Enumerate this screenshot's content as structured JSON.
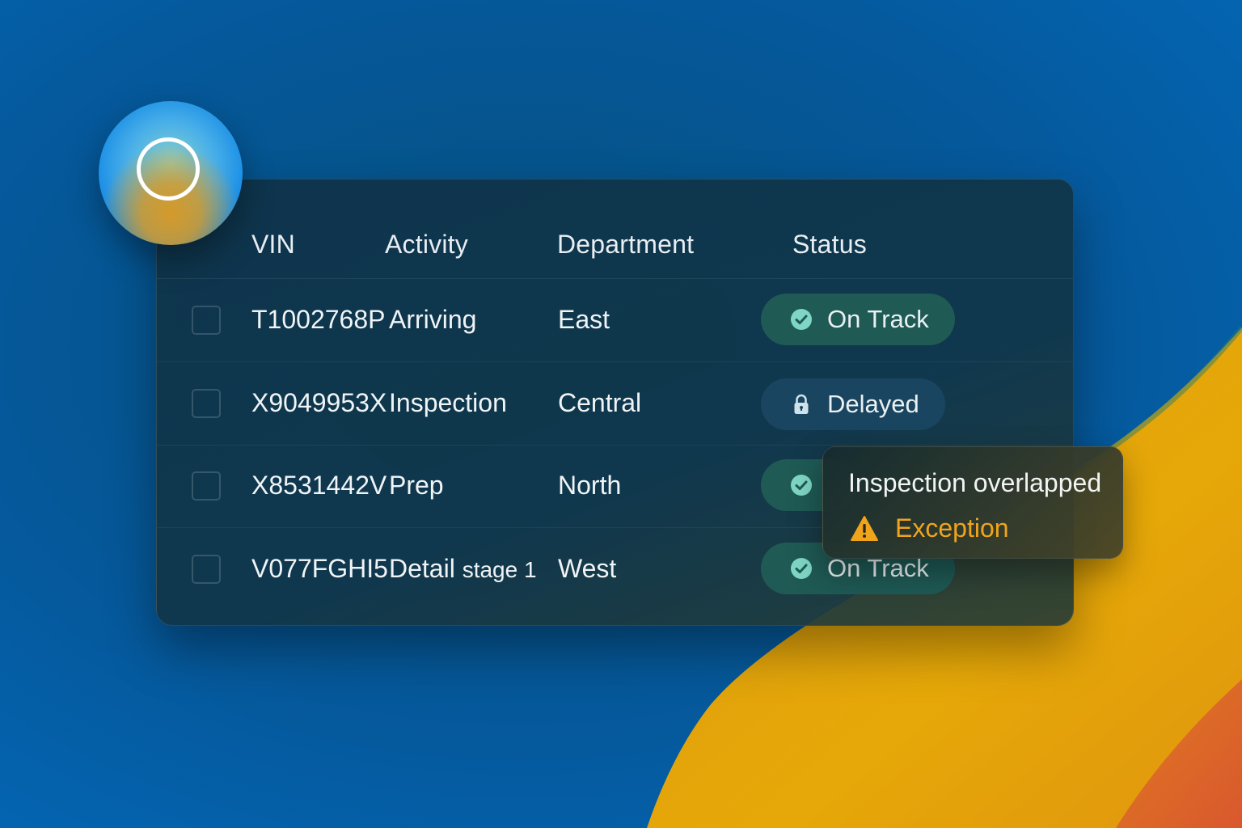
{
  "colors": {
    "accent_ok": "#1f5a55",
    "accent_check": "#7fd6c4",
    "accent_warning": "#f0a41c",
    "panel": "#0e344a"
  },
  "assistant": {
    "icon": "ring-icon"
  },
  "table": {
    "headers": {
      "vin": "VIN",
      "activity": "Activity",
      "department": "Department",
      "status": "Status"
    },
    "rows": [
      {
        "vin": "T1002768P",
        "activity": "Arriving",
        "activity_suffix": "",
        "department": "East",
        "status": "On Track",
        "status_icon": "check-circle-icon"
      },
      {
        "vin": "X9049953X",
        "activity": "Inspection",
        "activity_suffix": "",
        "department": "Central",
        "status": "Delayed",
        "status_icon": "lock-icon"
      },
      {
        "vin": "X8531442V",
        "activity": "Prep",
        "activity_suffix": "",
        "department": "North",
        "status": "",
        "status_icon": "check-circle-icon"
      },
      {
        "vin": "V077FGHI5",
        "activity": "Detail",
        "activity_suffix": "stage 1",
        "department": "West",
        "status": "On Track",
        "status_icon": "check-circle-icon"
      }
    ]
  },
  "tooltip": {
    "title": "Inspection overlapped",
    "label": "Exception",
    "icon": "warning-icon"
  }
}
